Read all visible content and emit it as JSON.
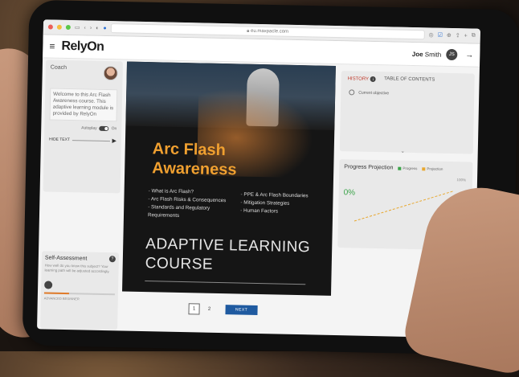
{
  "browser": {
    "url": "eu.maxpacle.com"
  },
  "header": {
    "logo": "RelyOn",
    "user_first": "Joe",
    "user_last": "Smith",
    "user_initials": "JS"
  },
  "coach": {
    "title": "Coach",
    "message": "Welcome to this Arc Flash Awareness course. This adaptive learning module is provided by RelyOn",
    "autoplay_label": "Autoplay",
    "autoplay_state": "On",
    "hide_text_label": "HIDE TEXT"
  },
  "self_assessment": {
    "title": "Self-Assessment",
    "description": "How well do you know this subject? Your learning path will be adjusted accordingly.",
    "level_label": "ADVANCED BEGINNER",
    "level_fraction": 0.35
  },
  "slide": {
    "title_line1": "Arc Flash",
    "title_line2": "Awareness",
    "bullets_left": [
      "What is Arc Flash?",
      "Arc Flash Risks & Consequences",
      "Standards and Regulatory Requirements"
    ],
    "bullets_right": [
      "PPE & Arc Flash Boundaries",
      "Mitigation Strategies",
      "Human Factors"
    ],
    "course_line1": "ADAPTIVE LEARNING",
    "course_line2": "COURSE"
  },
  "pager": {
    "page1": "1",
    "page2": "2",
    "next_label": "NEXT"
  },
  "history": {
    "tab_history": "HISTORY",
    "tab_toc": "TABLE OF CONTENTS",
    "current_objective": "Current objective"
  },
  "progress": {
    "title": "Progress Projection",
    "legend_progress": "Progress",
    "legend_projection": "Projection",
    "value": "0%",
    "max": "100%",
    "colors": {
      "progress": "#3aa348",
      "projection": "#e8a830"
    }
  }
}
